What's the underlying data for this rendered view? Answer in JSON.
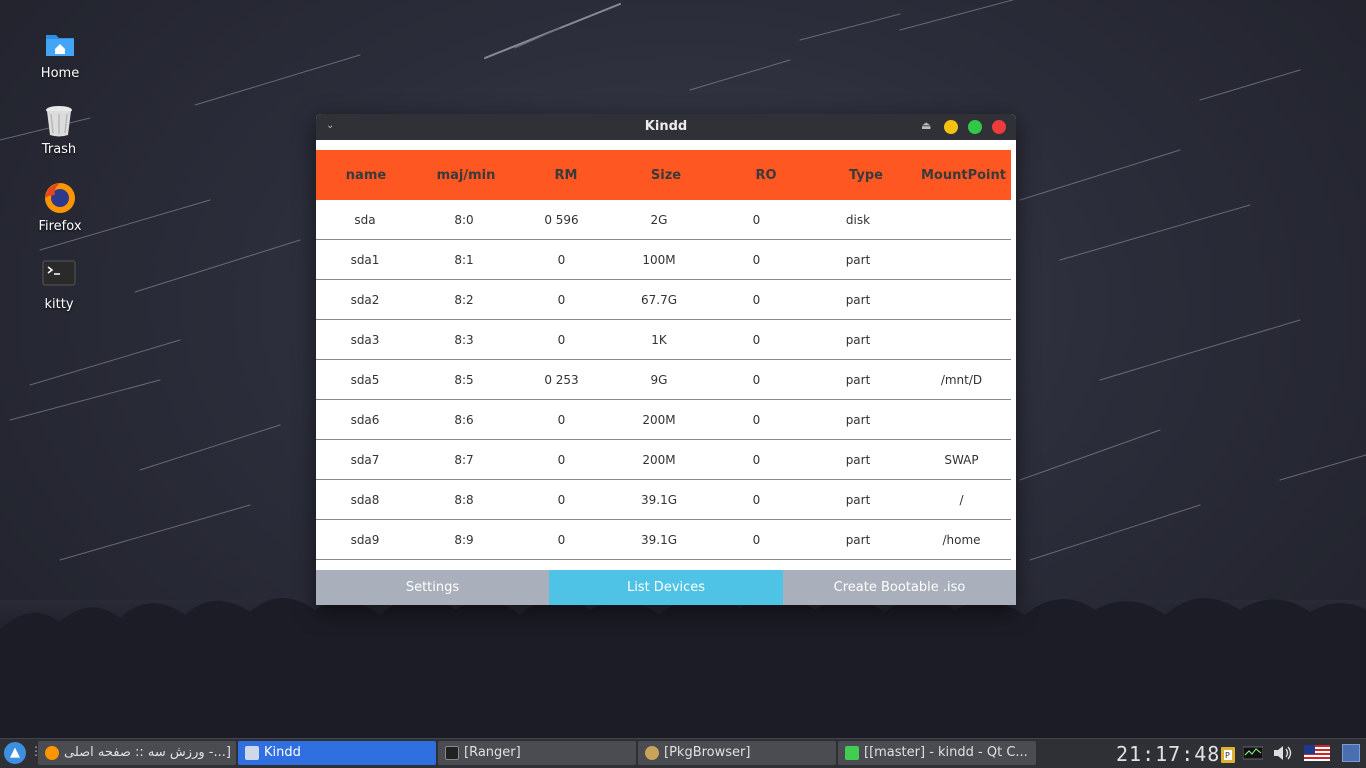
{
  "desktop": {
    "icons": [
      {
        "label": "Home",
        "icon": "home-folder-icon"
      },
      {
        "label": "Trash",
        "icon": "trash-icon"
      },
      {
        "label": "Firefox",
        "icon": "firefox-icon"
      },
      {
        "label": "kitty",
        "icon": "terminal-icon"
      }
    ]
  },
  "window": {
    "title": "Kindd",
    "menu_glyph": "⌄",
    "shade_glyph": "⏏",
    "colors": {
      "header": "#ff5722",
      "active_button": "#4fc3e6",
      "button": "#aab0bb"
    },
    "table": {
      "columns": [
        "name",
        "maj/min",
        "RM",
        "Size",
        "RO",
        "Type",
        "MountPoint"
      ],
      "rows": [
        [
          "sda",
          "8:0",
          "0 596",
          "2G",
          "0",
          "disk",
          ""
        ],
        [
          "sda1",
          "8:1",
          "0",
          "100M",
          "0",
          "part",
          ""
        ],
        [
          "sda2",
          "8:2",
          "0",
          "67.7G",
          "0",
          "part",
          ""
        ],
        [
          "sda3",
          "8:3",
          "0",
          "1K",
          "0",
          "part",
          ""
        ],
        [
          "sda5",
          "8:5",
          "0 253",
          "9G",
          "0",
          "part",
          "/mnt/D"
        ],
        [
          "sda6",
          "8:6",
          "0",
          "200M",
          "0",
          "part",
          ""
        ],
        [
          "sda7",
          "8:7",
          "0",
          "200M",
          "0",
          "part",
          "SWAP"
        ],
        [
          "sda8",
          "8:8",
          "0",
          "39.1G",
          "0",
          "part",
          "/"
        ],
        [
          "sda9",
          "8:9",
          "0",
          "39.1G",
          "0",
          "part",
          "/home"
        ]
      ]
    },
    "buttons": {
      "settings": "Settings",
      "list_devices": "List Devices",
      "create_iso": "Create Bootable .iso"
    }
  },
  "taskbar": {
    "start_glyph": "▲",
    "separator": "⋮",
    "tasks": [
      {
        "label": "ورزش سه :: صفحه اصلی -...]",
        "icon": "firefox-icon",
        "active": false
      },
      {
        "label": "Kindd",
        "icon": "window-icon",
        "active": true
      },
      {
        "label": "[Ranger]",
        "icon": "terminal-icon",
        "active": false
      },
      {
        "label": "[PkgBrowser]",
        "icon": "package-search-icon",
        "active": false
      },
      {
        "label": "[[master] - kindd - Qt C...",
        "icon": "qt-creator-icon",
        "active": false
      }
    ],
    "clock": "21:17:48",
    "tray": [
      "clipboard-icon",
      "system-monitor-icon",
      "volume-icon",
      "us-flag-icon",
      "desktop-icon"
    ]
  }
}
